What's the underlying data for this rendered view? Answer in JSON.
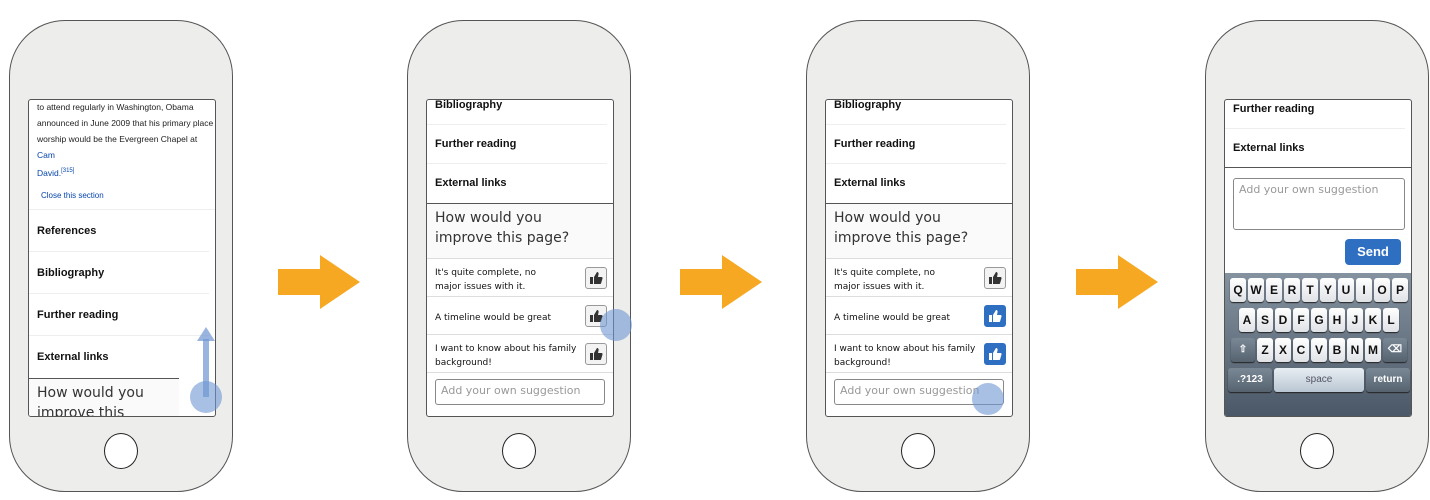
{
  "phones": [
    {
      "paragraph": {
        "lines": [
          "to attend regularly in Washington, Obama",
          "announced in June 2009 that his primary place",
          "worship would be the Evergreen Chapel at "
        ],
        "link_tail": "Cam",
        "link_line": "David.",
        "citation": "[315]"
      },
      "close_section": "Close this section",
      "sections": [
        "References",
        "Bibliography",
        "Further reading",
        "External links"
      ],
      "feedback_title": "How would you improve this page?",
      "gesture": "swipe-up"
    },
    {
      "sections": [
        "Bibliography",
        "Further reading",
        "External links"
      ],
      "feedback_title": "How would you improve this page?",
      "suggestions": [
        {
          "text": "It's quite complete, no major issues with it.",
          "liked": false
        },
        {
          "text": "A timeline would be great",
          "liked": false
        },
        {
          "text": "I want to know about his family background!",
          "liked": false
        }
      ],
      "input_placeholder": "Add your own suggestion",
      "gesture": "tap-like"
    },
    {
      "sections": [
        "Bibliography",
        "Further reading",
        "External links"
      ],
      "feedback_title": "How would you improve this page?",
      "suggestions": [
        {
          "text": "It's quite complete, no major issues with it.",
          "liked": false
        },
        {
          "text": "A timeline would be great",
          "liked": true
        },
        {
          "text": "I want to know about his family background!",
          "liked": true
        }
      ],
      "input_placeholder": "Add your own suggestion",
      "gesture": "tap-input"
    },
    {
      "sections": [
        "Further reading",
        "External links"
      ],
      "textarea_placeholder": "Add your own suggestion",
      "send_label": "Send",
      "keyboard": {
        "row1": [
          "Q",
          "W",
          "E",
          "R",
          "T",
          "Y",
          "U",
          "I",
          "O",
          "P"
        ],
        "row2": [
          "A",
          "S",
          "D",
          "F",
          "G",
          "H",
          "J",
          "K",
          "L"
        ],
        "row3": [
          "Z",
          "X",
          "C",
          "V",
          "B",
          "N",
          "M"
        ],
        "shift": "⇧",
        "backspace": "⌫",
        "numbers": ".?123",
        "space": "space",
        "return": "return"
      }
    }
  ],
  "colors": {
    "arrow": "#f7a823",
    "like_active": "#2e6fc2",
    "touch": "#6e96d2",
    "link": "#0645ad"
  }
}
